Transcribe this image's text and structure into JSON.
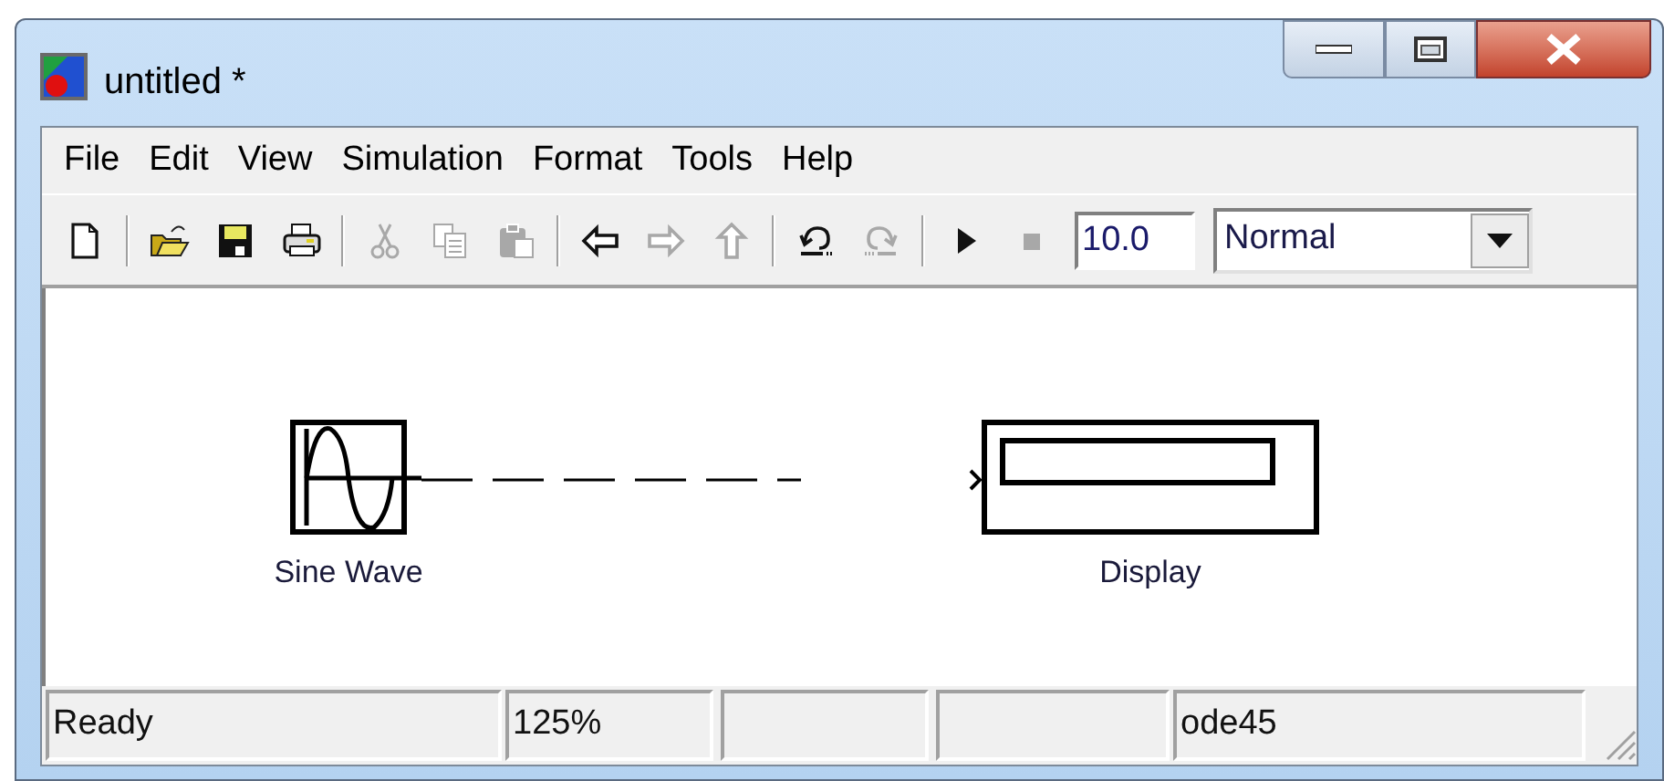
{
  "window": {
    "title": "untitled *"
  },
  "menu": [
    "File",
    "Edit",
    "View",
    "Simulation",
    "Format",
    "Tools",
    "Help"
  ],
  "toolbar": {
    "buttons": [
      {
        "disabled": false
      },
      {
        "disabled": false
      },
      {
        "disabled": false
      },
      {
        "disabled": false
      },
      {
        "disabled": true
      },
      {
        "disabled": true
      },
      {
        "disabled": true
      },
      {
        "disabled": false
      },
      {
        "disabled": true
      },
      {
        "disabled": true
      },
      {
        "disabled": false
      },
      {
        "disabled": true
      },
      {
        "disabled": false
      },
      {
        "disabled": true
      }
    ],
    "stop_time": "10.0",
    "mode": "Normal"
  },
  "diagram": {
    "blocks": [
      {
        "kind": "sine",
        "label": "Sine Wave"
      },
      {
        "kind": "display",
        "label": "Display"
      }
    ],
    "signal": {
      "connected": false
    }
  },
  "status_bar": {
    "state": "Ready",
    "zoom": "125%",
    "solver": "ode45"
  }
}
